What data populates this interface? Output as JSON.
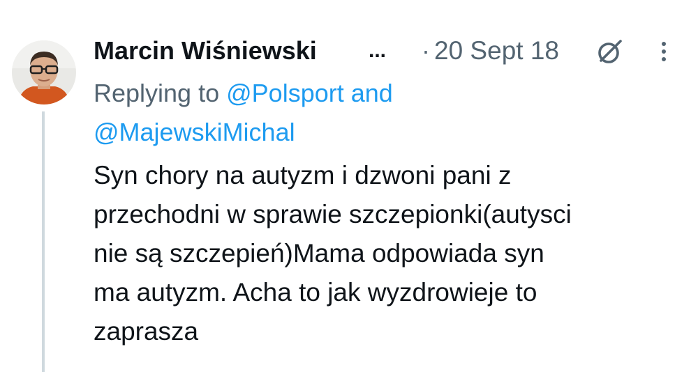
{
  "tweet": {
    "author_name": "Marcin Wiśniewski",
    "name_truncation": "...",
    "separator": "·",
    "date": "20 Sept 18",
    "icons": {
      "grok": "grok-icon",
      "more": "more-vertical-icon",
      "avatar": "avatar"
    },
    "reply": {
      "prefix": "Replying to",
      "mention_1": "@Polsport",
      "and_word": "and",
      "mention_2": "@MajewskiMichal"
    },
    "body_lines": [
      "Syn chory na autyzm i dzwoni pani z",
      "przechodni w sprawie szczepionki(autysci",
      "nie są szczepień)Mama odpowiada syn",
      "ma autyzm. Acha to jak wyzdrowieje to",
      "zaprasza"
    ],
    "colors": {
      "text": "#0f1419",
      "secondary": "#536471",
      "link": "#1d9bf0",
      "thread_line": "#cfd9de"
    }
  }
}
